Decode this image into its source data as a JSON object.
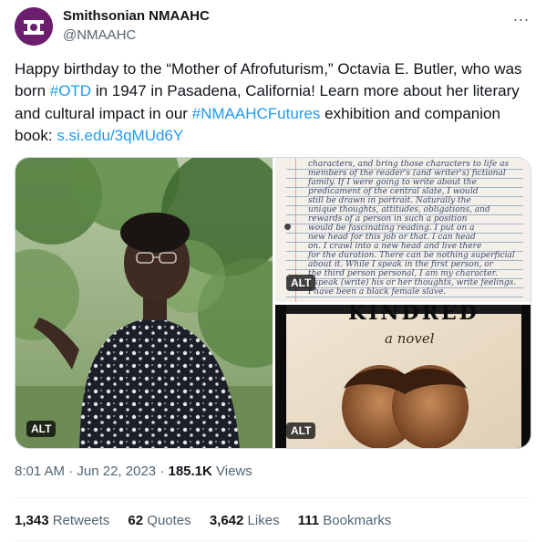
{
  "author": {
    "name": "Smithsonian NMAAHC",
    "handle": "@NMAAHC",
    "avatar_icon": "smithsonian-sun-logo-icon",
    "avatar_color": "#6b1d6e"
  },
  "more_icon": "...",
  "tweet": {
    "part1": "Happy birthday to the “Mother of Afrofuturism,” Octavia E. Butler, who was born ",
    "hashtag1": "#OTD",
    "part2": " in 1947 in Pasadena, California! Learn more about her literary and cultural impact in our ",
    "hashtag2": "#NMAAHCFutures",
    "part3": " exhibition and companion book: ",
    "url": "s.si.edu/3qMUd6Y"
  },
  "media": {
    "alt_label": "ALT",
    "book_title": "KINDRED",
    "book_subtitle": "a novel",
    "manuscript_lines": [
      "characters, and bring those characters to life as",
      "members of the reader's (and writer's) fictional",
      "family. If I were going to write about the",
      "predicament of the central slate, I would",
      "still be drawn in portrait. Naturally the",
      "unique thoughts, attitudes, obligations, and",
      "rewards of a person in such a position",
      "would be fascinating reading. I put on a",
      "new head for this job or that. I can head",
      "on. I crawl into a new head and live there",
      "for the duration. There can be nothing superficial",
      "about it. While I speak in the first person, or",
      "the third person personal, I am my character.",
      "I speak (write) his or her thoughts, write feelings.",
      "I have been a black female slave."
    ]
  },
  "meta": {
    "time": "8:01 AM",
    "separator": "·",
    "date": "Jun 22, 2023",
    "views_count": "185.1K",
    "views_label": "Views"
  },
  "stats": [
    {
      "count": "1,343",
      "label": "Retweets"
    },
    {
      "count": "62",
      "label": "Quotes"
    },
    {
      "count": "3,642",
      "label": "Likes"
    },
    {
      "count": "111",
      "label": "Bookmarks"
    }
  ],
  "colors": {
    "link": "#1d9bf0",
    "secondary_text": "#536471",
    "primary_text": "#0f1419"
  }
}
